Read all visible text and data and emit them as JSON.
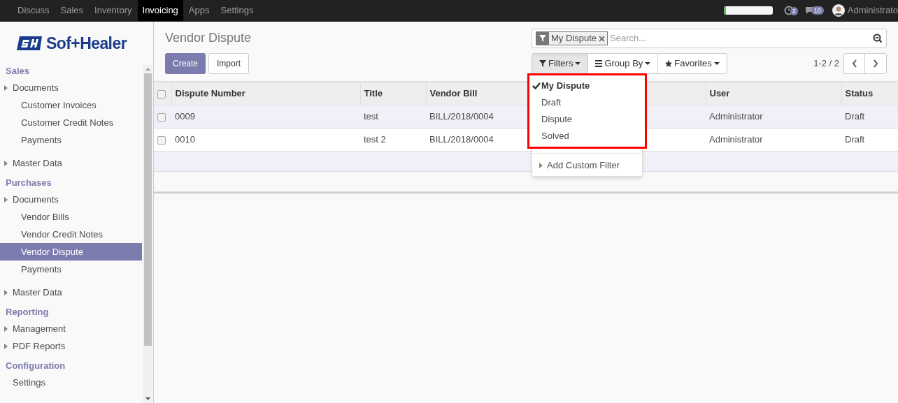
{
  "top_menu": [
    {
      "label": "Discuss",
      "selected": false
    },
    {
      "label": "Sales",
      "selected": false
    },
    {
      "label": "Inventory",
      "selected": false
    },
    {
      "label": "Invoicing",
      "selected": true
    },
    {
      "label": "Apps",
      "selected": false
    },
    {
      "label": "Settings",
      "selected": false
    }
  ],
  "systray": {
    "progress": {
      "level": 0.05
    },
    "activity_count": "2",
    "message_count": "10",
    "user": "Administrato"
  },
  "logo": {
    "text": "Sof+Healer"
  },
  "sidebar": {
    "sections": [
      {
        "title": "Sales",
        "items": [
          {
            "label": "Documents",
            "kind": "folder",
            "selected": false,
            "children": [
              {
                "label": "Customer Invoices",
                "selected": false
              },
              {
                "label": "Customer Credit Notes",
                "selected": false
              },
              {
                "label": "Payments",
                "selected": false
              }
            ]
          },
          {
            "label": "Master Data",
            "kind": "folder",
            "selected": false
          }
        ]
      },
      {
        "title": "Purchases",
        "items": [
          {
            "label": "Documents",
            "kind": "folder",
            "selected": false,
            "children": [
              {
                "label": "Vendor Bills",
                "selected": false
              },
              {
                "label": "Vendor Credit Notes",
                "selected": false
              },
              {
                "label": "Vendor Dispute",
                "selected": true
              },
              {
                "label": "Payments",
                "selected": false
              }
            ]
          },
          {
            "label": "Master Data",
            "kind": "folder",
            "selected": false
          }
        ]
      },
      {
        "title": "Reporting",
        "items": [
          {
            "label": "Management",
            "kind": "folder",
            "selected": false
          },
          {
            "label": "PDF Reports",
            "kind": "folder",
            "selected": false
          }
        ]
      },
      {
        "title": "Configuration",
        "items": [
          {
            "label": "Settings",
            "kind": "folder_plain",
            "selected": false
          }
        ]
      }
    ]
  },
  "breadcrumb": "Vendor Dispute",
  "buttons": {
    "create": "Create",
    "import": "Import"
  },
  "search": {
    "facet": "My Dispute",
    "placeholder": "Search..."
  },
  "search_options": [
    {
      "label": "Filters",
      "kind": "filter",
      "expanded": true
    },
    {
      "label": "Group By",
      "kind": "group",
      "expanded": false
    },
    {
      "label": "Favorites",
      "kind": "star",
      "expanded": false
    }
  ],
  "pager": "1-2 / 2",
  "table": {
    "columns": [
      "Dispute Number",
      "Title",
      "Vendor Bill",
      "User",
      "Status"
    ],
    "select_all": {
      "checked": false
    },
    "rows": [
      {
        "checked": false,
        "cells": [
          "0009",
          "test",
          "BILL/2018/0004",
          "Administrator",
          "Draft"
        ]
      },
      {
        "checked": false,
        "cells": [
          "0010",
          "test 2",
          "BILL/2018/0004",
          "Administrator",
          "Draft"
        ]
      }
    ]
  },
  "filters_menu": {
    "items": [
      {
        "label": "My Dispute",
        "checked": true
      },
      {
        "label": "Draft",
        "checked": false
      },
      {
        "label": "Dispute",
        "checked": false
      },
      {
        "label": "Solved",
        "checked": false
      }
    ],
    "custom": "Add Custom Filter"
  }
}
